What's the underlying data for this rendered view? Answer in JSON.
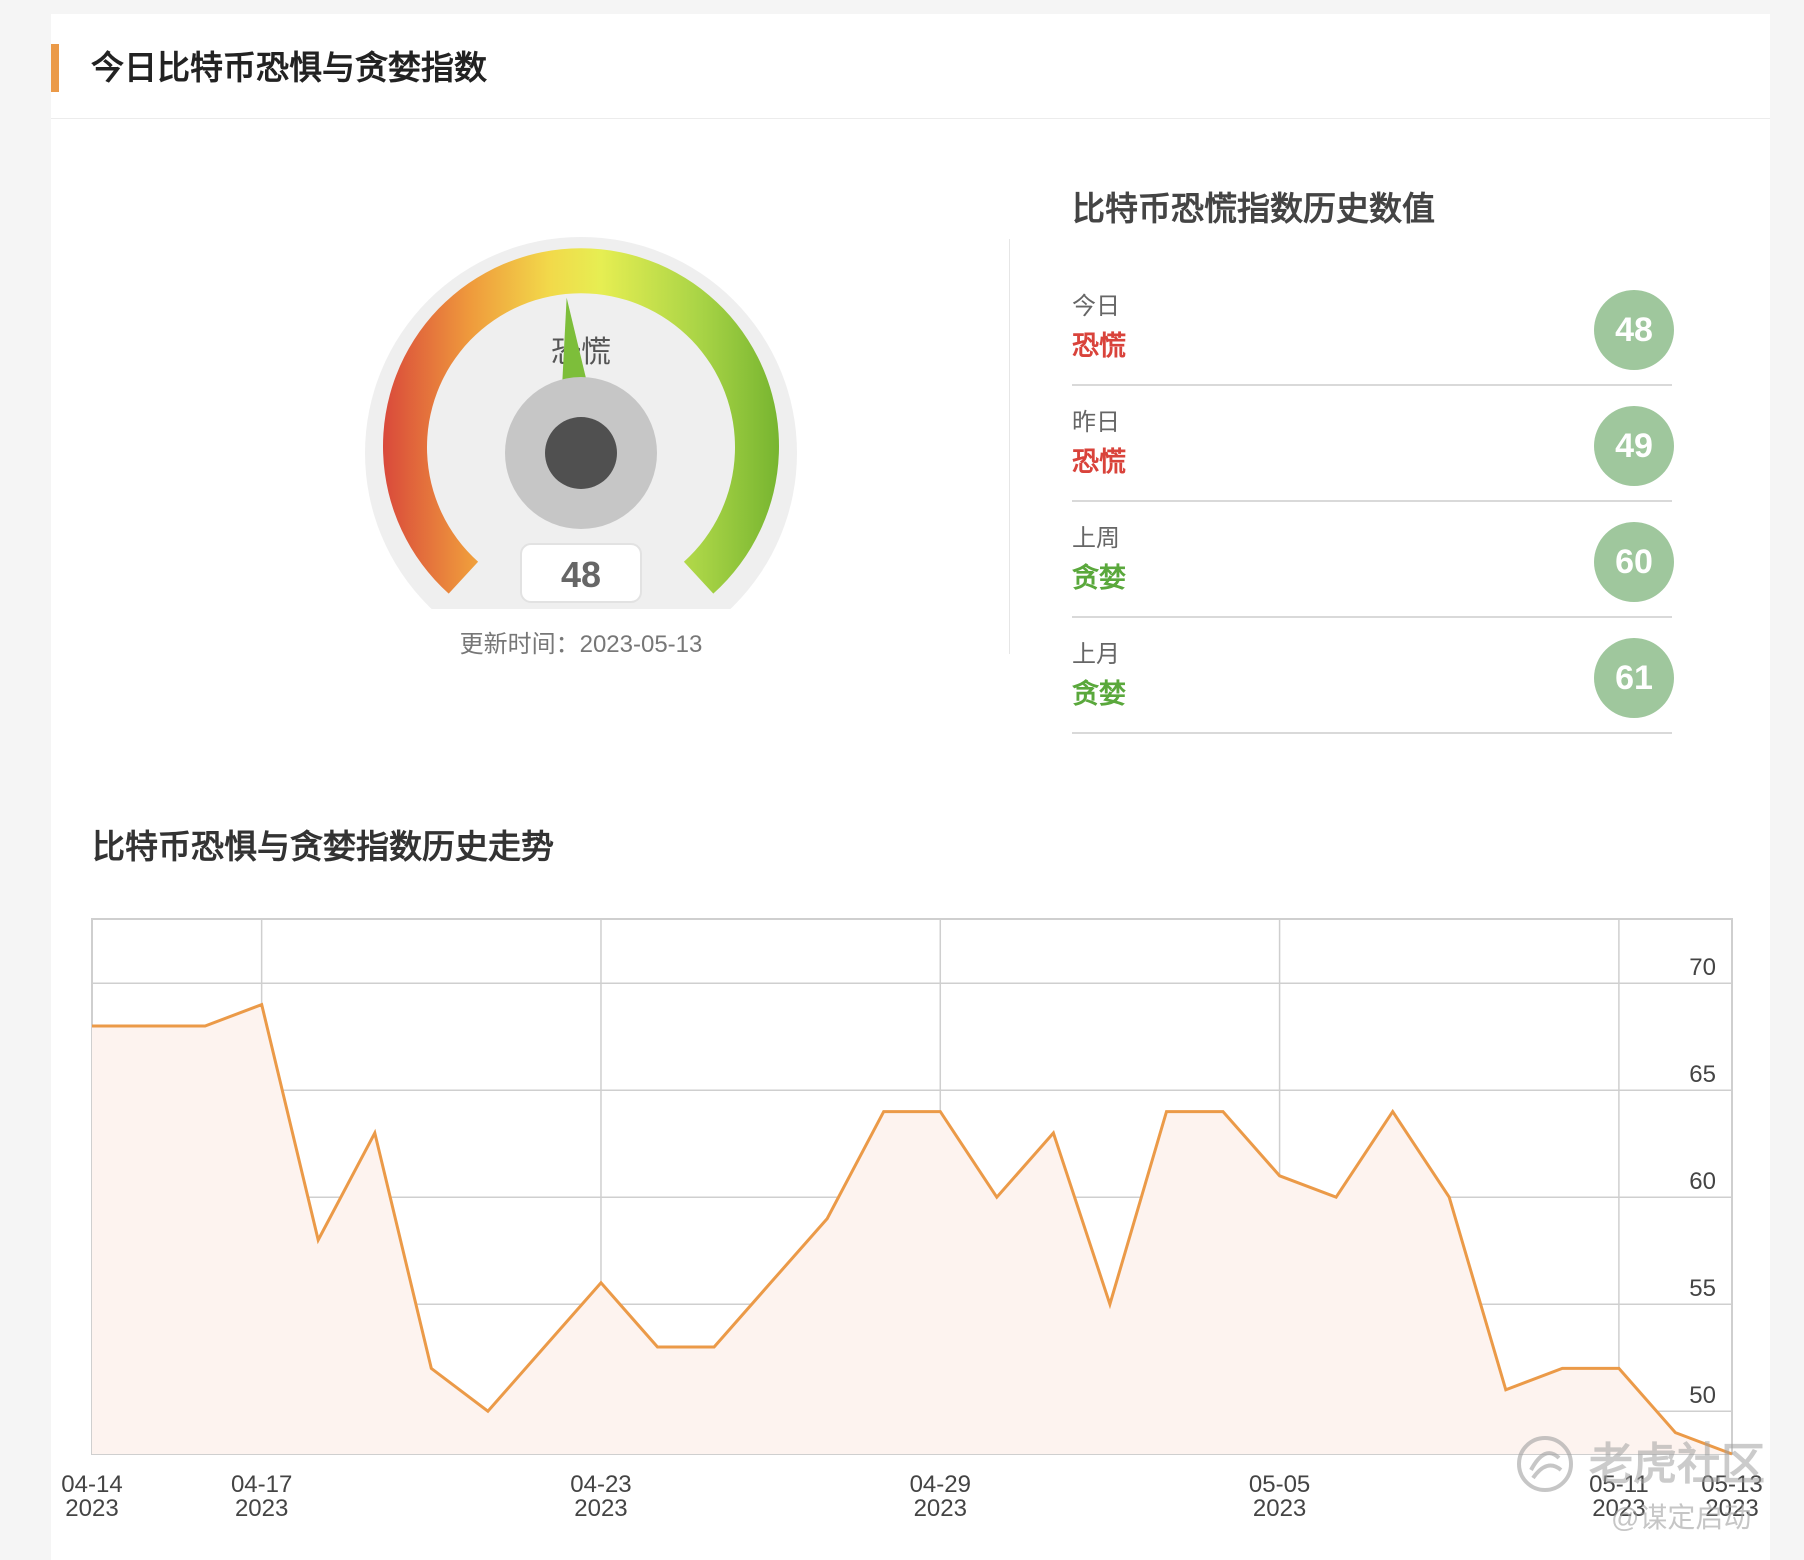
{
  "header": {
    "title": "今日比特币恐惧与贪婪指数"
  },
  "gauge": {
    "value": 48,
    "label": "恐慌",
    "min": 0,
    "max": 100
  },
  "update": {
    "text": "更新时间：2023-05-13"
  },
  "history": {
    "title": "比特币恐慌指数历史数值",
    "rows": [
      {
        "period": "今日",
        "status": "恐慌",
        "value": "48",
        "status_color": "#d9433b"
      },
      {
        "period": "昨日",
        "status": "恐慌",
        "value": "49",
        "status_color": "#d9433b"
      },
      {
        "period": "上周",
        "status": "贪婪",
        "value": "60",
        "status_color": "#5aa83c"
      },
      {
        "period": "上月",
        "status": "贪婪",
        "value": "61",
        "status_color": "#5aa83c"
      }
    ]
  },
  "chart_data": {
    "type": "area",
    "title": "比特币恐惧与贪婪指数历史走势",
    "x": [
      "2023-04-14",
      "2023-04-15",
      "2023-04-16",
      "2023-04-17",
      "2023-04-18",
      "2023-04-19",
      "2023-04-20",
      "2023-04-21",
      "2023-04-22",
      "2023-04-23",
      "2023-04-24",
      "2023-04-25",
      "2023-04-26",
      "2023-04-27",
      "2023-04-28",
      "2023-04-29",
      "2023-04-30",
      "2023-05-01",
      "2023-05-02",
      "2023-05-03",
      "2023-05-04",
      "2023-05-05",
      "2023-05-06",
      "2023-05-07",
      "2023-05-08",
      "2023-05-09",
      "2023-05-10",
      "2023-05-11",
      "2023-05-12",
      "2023-05-13"
    ],
    "series": [
      {
        "values": [
          68,
          68,
          68,
          69,
          58,
          63,
          52,
          50,
          53,
          56,
          53,
          53,
          56,
          59,
          64,
          64,
          60,
          63,
          55,
          64,
          64,
          61,
          60,
          64,
          60,
          51,
          52,
          52,
          49,
          48
        ]
      }
    ],
    "ylim": [
      48,
      73
    ],
    "yticks": [
      50,
      55,
      60,
      65,
      70
    ],
    "xtick_labels": [
      {
        "md": "04-14",
        "y": "2023"
      },
      {
        "md": "04-17",
        "y": "2023"
      },
      {
        "md": "04-23",
        "y": "2023"
      },
      {
        "md": "04-29",
        "y": "2023"
      },
      {
        "md": "05-05",
        "y": "2023"
      },
      {
        "md": "05-11",
        "y": "2023"
      },
      {
        "md": "05-13",
        "y": "2023"
      }
    ],
    "grid": true,
    "y_axis_position": "right",
    "line_color": "#eb9a48",
    "fill_color": "#fdf3ef"
  },
  "watermark": {
    "main": "老虎社区",
    "sub": "@谋定启动"
  }
}
